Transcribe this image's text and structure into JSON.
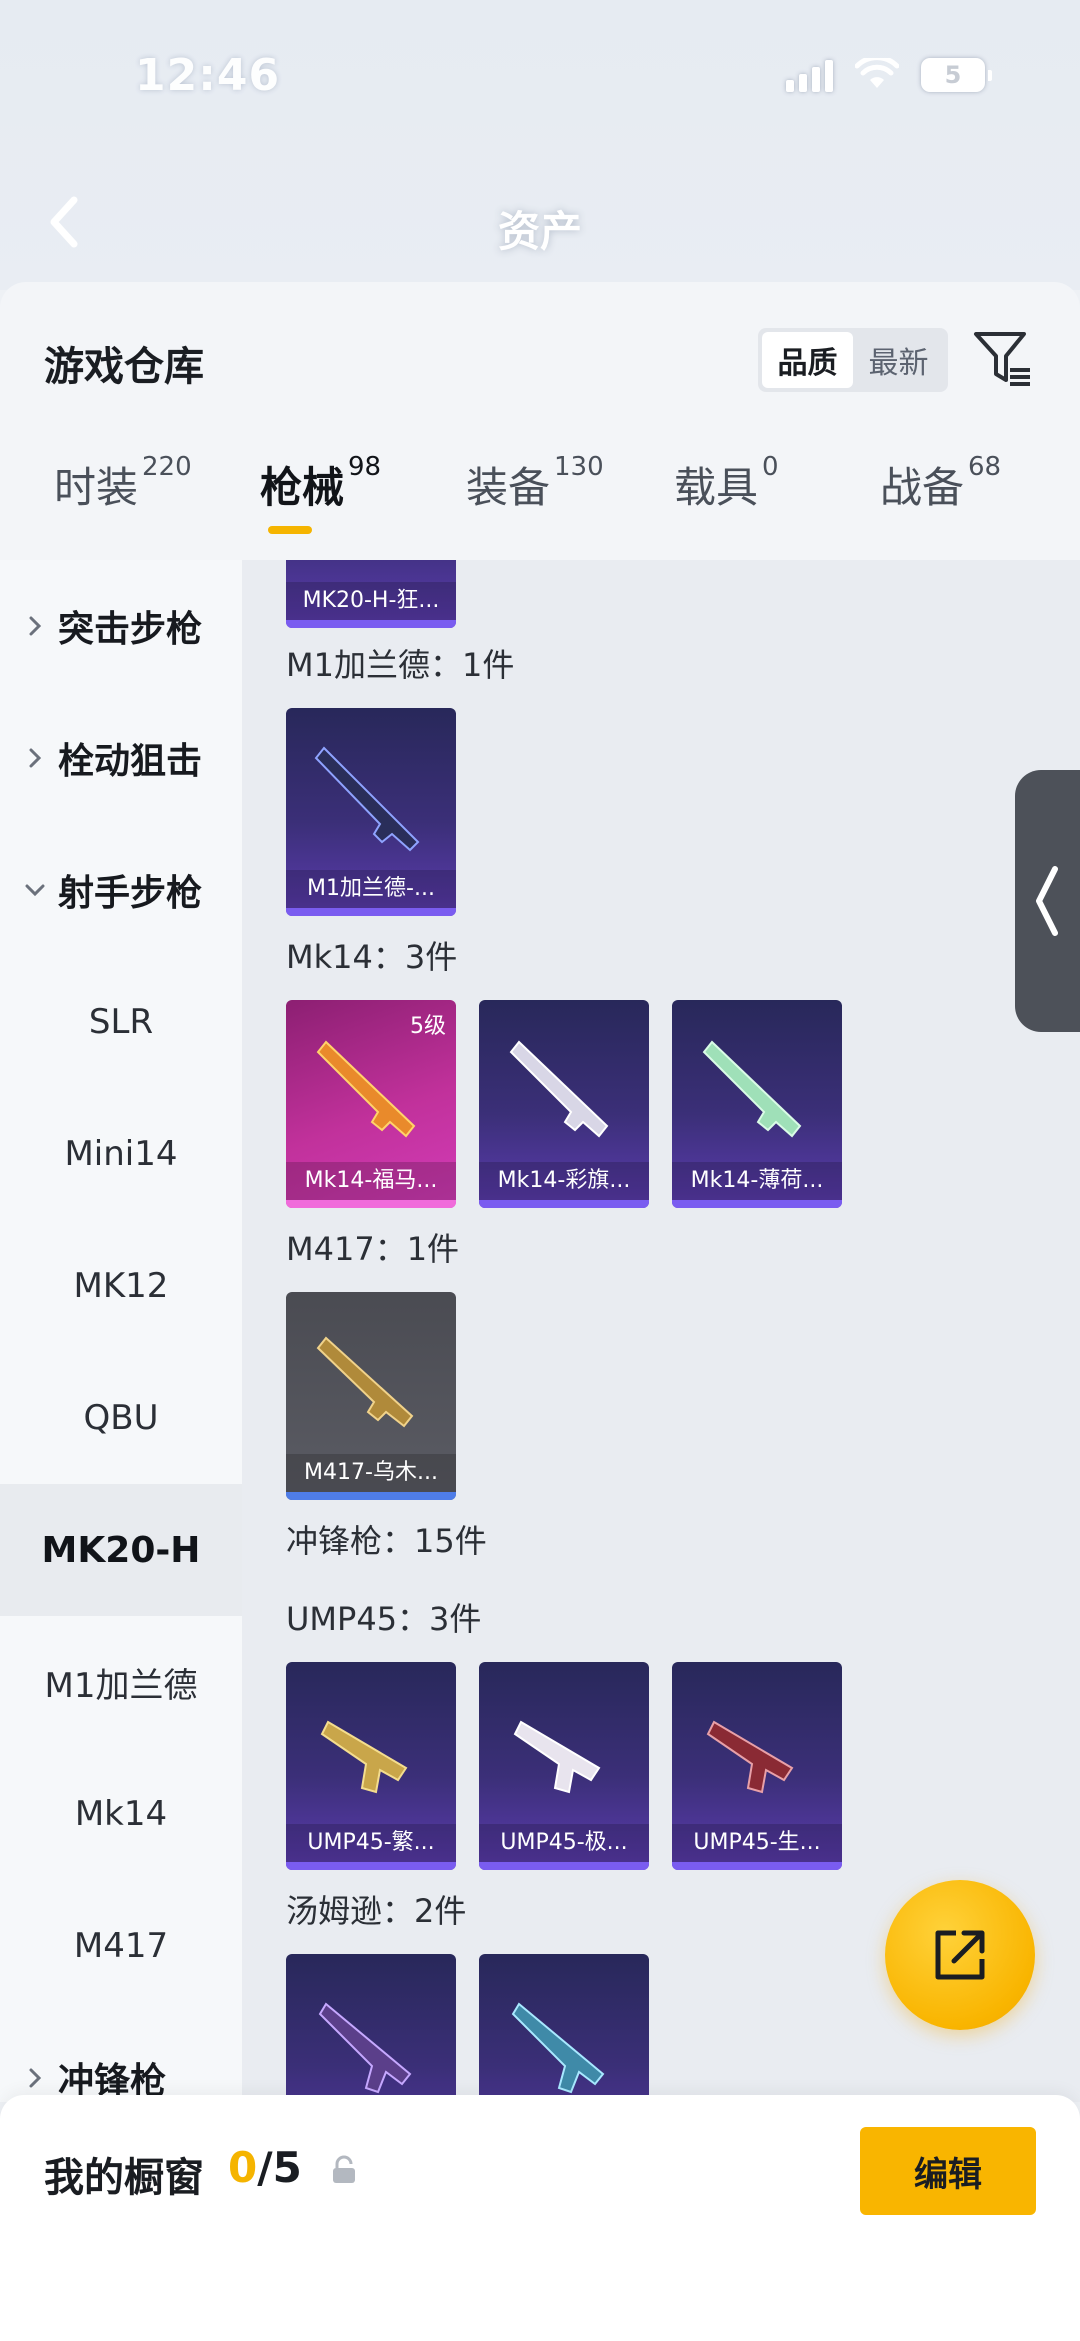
{
  "status_bar": {
    "time": "12:46",
    "battery": "5"
  },
  "nav": {
    "title": "资产"
  },
  "warehouse": {
    "title": "游戏仓库",
    "sort_options": [
      "品质",
      "最新"
    ],
    "tabs": [
      {
        "label": "时装",
        "count": "220"
      },
      {
        "label": "枪械",
        "count": "98"
      },
      {
        "label": "装备",
        "count": "130"
      },
      {
        "label": "载具",
        "count": "0"
      },
      {
        "label": "战备",
        "count": "68"
      }
    ]
  },
  "sidebar": {
    "items": [
      {
        "label": "突击步枪",
        "type": "group"
      },
      {
        "label": "栓动狙击",
        "type": "group"
      },
      {
        "label": "射手步枪",
        "type": "group-open"
      },
      {
        "label": "SLR",
        "type": "sub"
      },
      {
        "label": "Mini14",
        "type": "sub"
      },
      {
        "label": "MK12",
        "type": "sub"
      },
      {
        "label": "QBU",
        "type": "sub"
      },
      {
        "label": "MK20-H",
        "type": "active"
      },
      {
        "label": "M1加兰德",
        "type": "sub"
      },
      {
        "label": "Mk14",
        "type": "sub"
      },
      {
        "label": "M417",
        "type": "sub"
      },
      {
        "label": "冲锋枪",
        "type": "group"
      }
    ]
  },
  "content": {
    "sections": [
      {
        "label": "M1加兰德：1件"
      },
      {
        "label": "Mk14：3件"
      },
      {
        "label": "M417：1件"
      },
      {
        "label": "冲锋枪：15件"
      },
      {
        "label": "UMP45：3件"
      },
      {
        "label": "汤姆逊：2件"
      }
    ],
    "cards": [
      {
        "name": "MK20-H-狂..."
      },
      {
        "name": "M1加兰德-..."
      },
      {
        "name": "Mk14-福马...",
        "level": "5级"
      },
      {
        "name": "Mk14-彩旗..."
      },
      {
        "name": "Mk14-薄荷..."
      },
      {
        "name": "M417-乌木..."
      },
      {
        "name": "UMP45-繁..."
      },
      {
        "name": "UMP45-极..."
      },
      {
        "name": "UMP45-生..."
      },
      {
        "name": ""
      },
      {
        "name": ""
      }
    ]
  },
  "showcase": {
    "title": "我的橱窗",
    "current": "0",
    "total": "/5",
    "edit_label": "编辑"
  },
  "colors": {
    "accent": "#f9b500",
    "indicator": "#f5b400",
    "card_purple": "#3b2f78",
    "card_gold": "#c1319b",
    "card_grey": "#5b5c64"
  }
}
